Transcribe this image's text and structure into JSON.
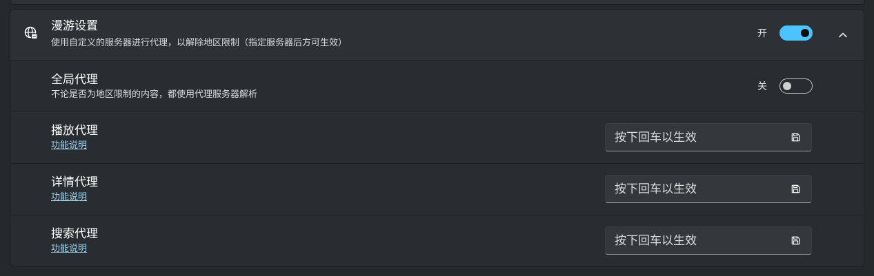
{
  "roaming": {
    "title": "漫游设置",
    "description": "使用自定义的服务器进行代理，以解除地区限制（指定服务器后方可生效）",
    "toggle_label": "开",
    "toggle_state": "on",
    "icon": "globe-icon",
    "collapse_icon": "chevron-up-icon"
  },
  "global_proxy": {
    "title": "全局代理",
    "description": "不论是否为地区限制的内容，都使用代理服务器解析",
    "toggle_label": "关",
    "toggle_state": "off"
  },
  "proxies": [
    {
      "title": "播放代理",
      "link": "功能说明",
      "placeholder": "按下回车以生效",
      "value": "",
      "icon": "save-icon"
    },
    {
      "title": "详情代理",
      "link": "功能说明",
      "placeholder": "按下回车以生效",
      "value": "",
      "icon": "save-icon"
    },
    {
      "title": "搜索代理",
      "link": "功能说明",
      "placeholder": "按下回车以生效",
      "value": "",
      "icon": "save-icon"
    }
  ],
  "colors": {
    "accent": "#4cc2ff",
    "link": "#9dd4f0",
    "background": "#25292c",
    "card": "#2b2f33"
  }
}
